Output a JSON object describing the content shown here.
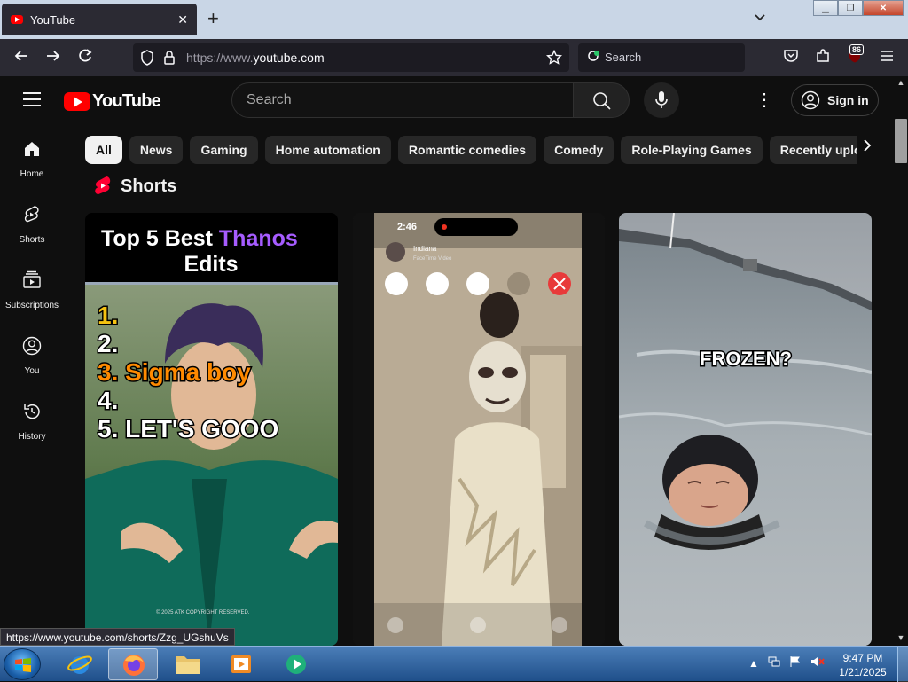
{
  "browser": {
    "tab_title": "YouTube",
    "tab_close": "✕",
    "new_tab": "+",
    "url_prefix": "https://www.",
    "url_domain": "youtube.com",
    "search_placeholder": "Search",
    "notification_count": "86"
  },
  "youtube": {
    "logo_text": "YouTube",
    "search_placeholder": "Search",
    "sign_in": "Sign in",
    "guide": [
      {
        "label": "Home",
        "icon": "home-icon"
      },
      {
        "label": "Shorts",
        "icon": "shorts-icon"
      },
      {
        "label": "Subscriptions",
        "icon": "subscriptions-icon"
      },
      {
        "label": "You",
        "icon": "you-icon"
      },
      {
        "label": "History",
        "icon": "history-icon"
      }
    ],
    "chips": [
      "All",
      "News",
      "Gaming",
      "Home automation",
      "Romantic comedies",
      "Comedy",
      "Role-Playing Games",
      "Recently uploaded"
    ],
    "shorts_title": "Shorts",
    "cards": [
      {
        "title_white": "Top 5 Best",
        "title_accent": "Thanos",
        "title_line2": "Edits",
        "list": [
          "1.",
          "2.",
          "3. Sigma boy",
          "4.",
          "5. LET'S GOOO"
        ],
        "copyright": "© 2025 ATK COPYRIGHT RESERVED.",
        "accent_color": "#a65cff"
      },
      {
        "time": "2:46",
        "caller": "Indiana",
        "call_type": "FaceTime Video"
      },
      {
        "caption": "FROZEN?"
      }
    ]
  },
  "status_url": "https://www.youtube.com/shorts/Zzg_UGshuVs",
  "taskbar": {
    "time": "9:47 PM",
    "date": "1/21/2025"
  }
}
